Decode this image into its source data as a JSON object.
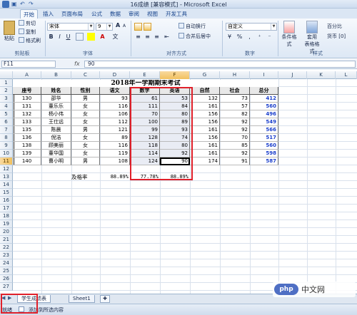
{
  "window": {
    "title": "16成绩 [兼容模式] - Microsoft Excel"
  },
  "ribbon": {
    "tabs": [
      "开始",
      "插入",
      "页面布局",
      "公式",
      "数据",
      "审阅",
      "视图",
      "开发工具"
    ],
    "clipboard": {
      "cut": "剪切",
      "copy": "复制",
      "paste": "粘贴",
      "format_painter": "格式刷",
      "group": "剪贴板"
    },
    "font": {
      "name": "宋体",
      "size": "9",
      "group": "字体",
      "bold": "B",
      "italic": "I",
      "underline": "U",
      "grow": "A",
      "shrink": "A",
      "bigA": "A",
      "wen": "文"
    },
    "alignment": {
      "wrap": "自动换行",
      "merge": "合并后居中",
      "group": "对齐方式"
    },
    "number": {
      "format": "自定义",
      "group": "数字",
      "percent": "%",
      "comma": ",",
      "pct_label": "%"
    },
    "styles": {
      "conditional": "条件格式",
      "table": "套用\n表格格式",
      "percent_style": "百分比",
      "currency_style": "货币 [0]",
      "group": "样式"
    }
  },
  "formula_bar": {
    "name_box": "F11",
    "fx": "fx",
    "content": "90"
  },
  "columns": [
    "A",
    "B",
    "C",
    "D",
    "E",
    "F",
    "G",
    "H",
    "I",
    "J",
    "K",
    "L"
  ],
  "rows": [
    "1",
    "2",
    "3",
    "4",
    "5",
    "6",
    "7",
    "8",
    "9",
    "10",
    "11",
    "12",
    "13",
    "14",
    "15",
    "16",
    "17",
    "18",
    "19",
    "20",
    "21",
    "22",
    "23",
    "24",
    "25",
    "26",
    "27"
  ],
  "sheet": {
    "title": "2018年一学期期末考试",
    "headers": [
      "座号",
      "姓名",
      "性别",
      "语文",
      "数学",
      "英语",
      "自然",
      "社会",
      "总分"
    ],
    "data": [
      [
        "130",
        "邵华",
        "男",
        "93",
        "61",
        "53",
        "132",
        "73",
        "412"
      ],
      [
        "131",
        "董乐乐",
        "女",
        "116",
        "111",
        "84",
        "161",
        "57",
        "560"
      ],
      [
        "132",
        "杨小伟",
        "女",
        "106",
        "70",
        "80",
        "156",
        "82",
        "496"
      ],
      [
        "133",
        "王仕远",
        "女",
        "112",
        "100",
        "89",
        "156",
        "92",
        "549"
      ],
      [
        "135",
        "陈晨",
        "男",
        "121",
        "99",
        "93",
        "161",
        "92",
        "566"
      ],
      [
        "136",
        "倪洁",
        "女",
        "89",
        "128",
        "74",
        "156",
        "70",
        "517"
      ],
      [
        "138",
        "顾美丽",
        "女",
        "116",
        "118",
        "80",
        "161",
        "85",
        "560"
      ],
      [
        "139",
        "董华国",
        "女",
        "119",
        "114",
        "92",
        "161",
        "92",
        "598"
      ],
      [
        "140",
        "曹小明",
        "男",
        "108",
        "124",
        "90",
        "174",
        "91",
        "587"
      ]
    ],
    "pass_label": "及格率",
    "pass_rates": [
      "88.89%",
      "77.78%",
      "88.89%"
    ]
  },
  "sheet_tabs": [
    "学生成绩表",
    "Sheet1"
  ],
  "status": {
    "ready": "就绪",
    "hint": "添加到所选内容"
  },
  "colors": {
    "accent": "#e0202a",
    "total": "#1b3fcc",
    "selection": "#f1c15f"
  }
}
